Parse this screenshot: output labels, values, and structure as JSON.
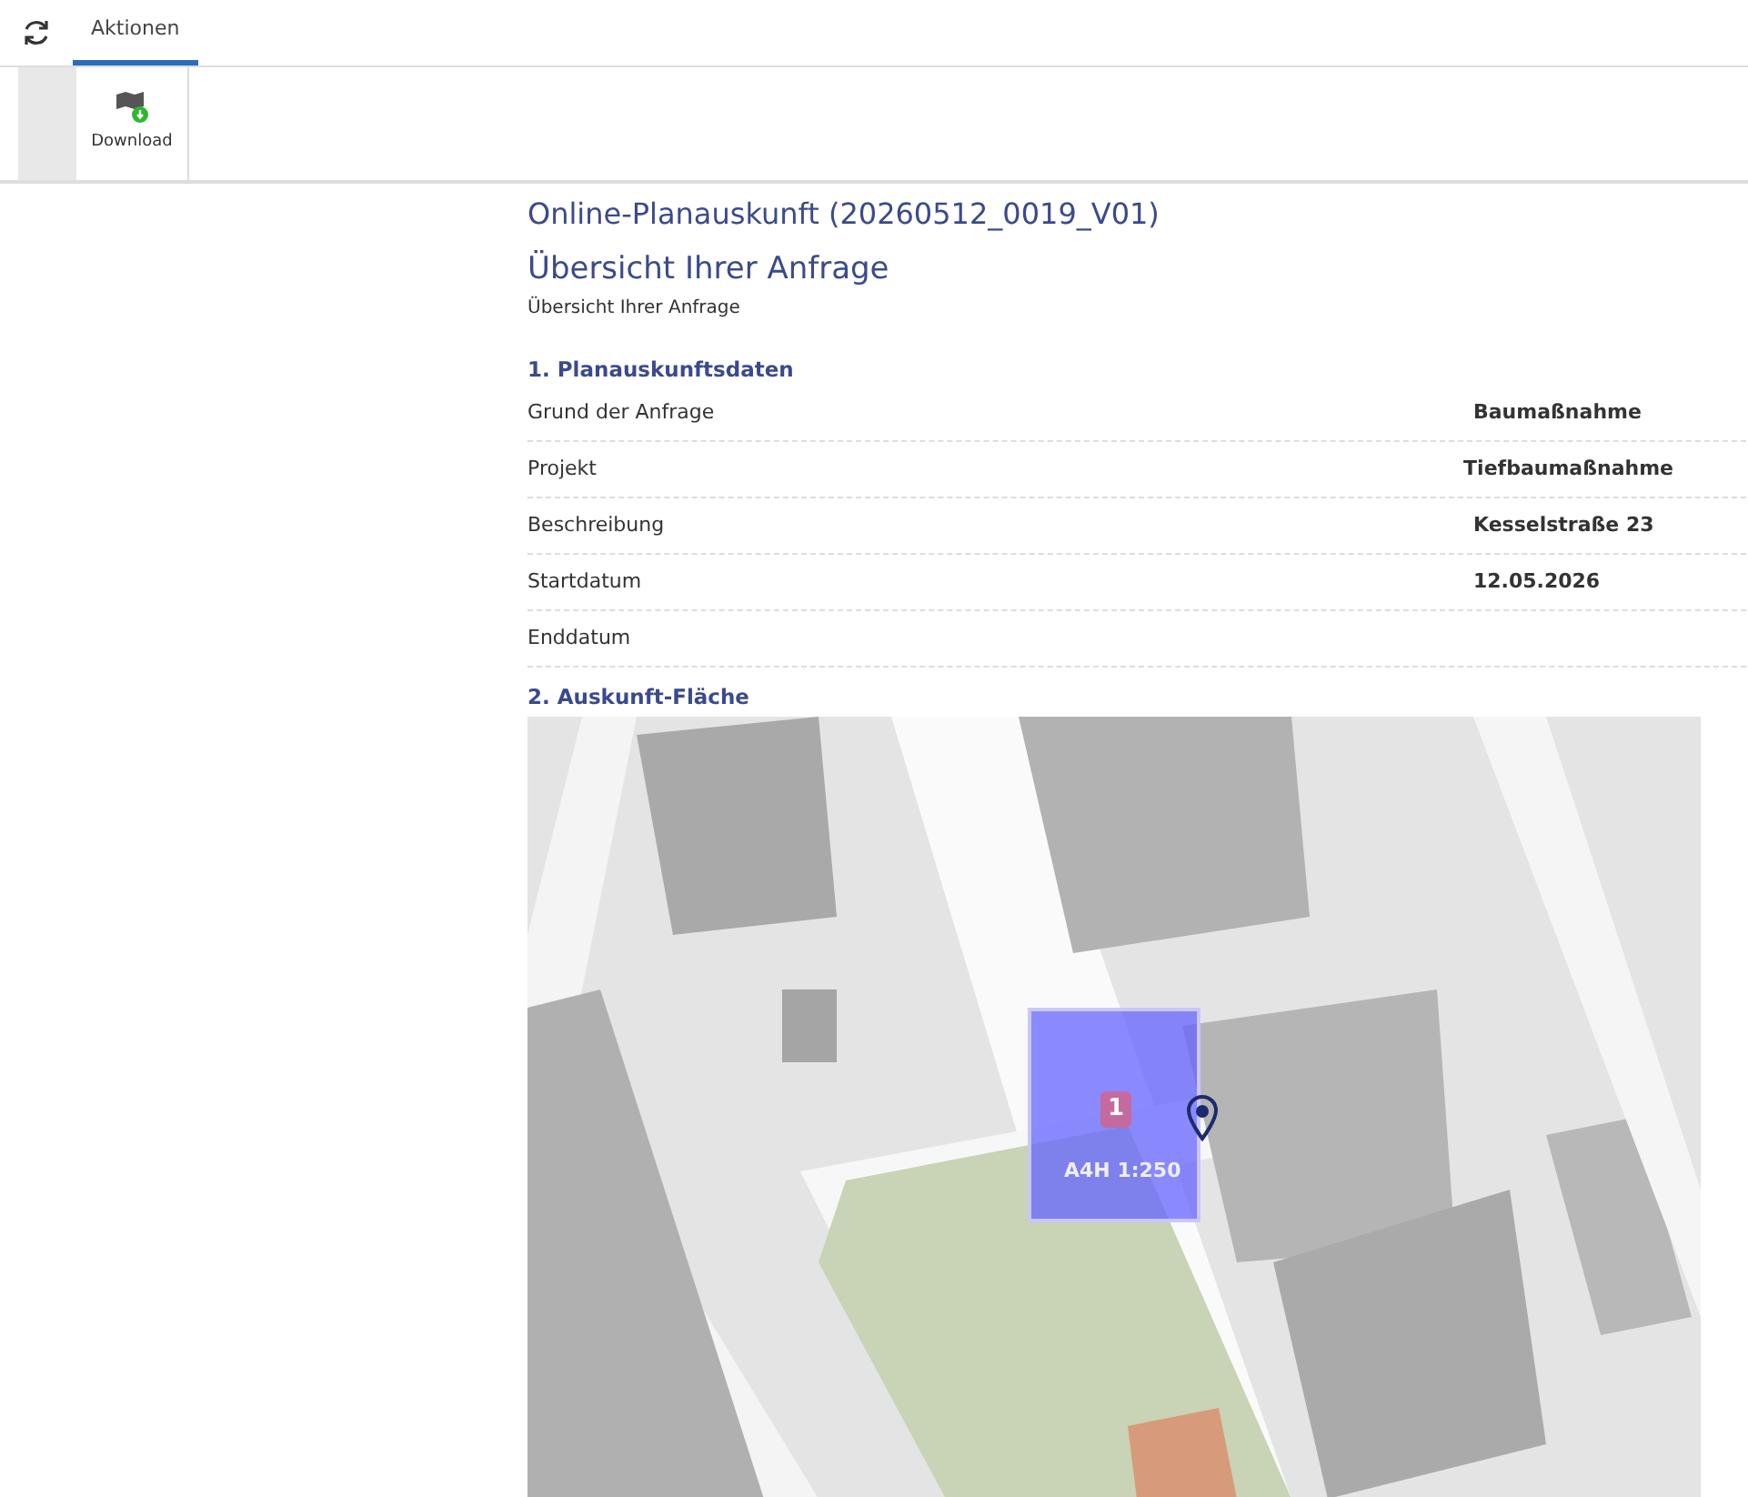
{
  "tabs": [
    {
      "label": "Aktionen",
      "selected": true
    }
  ],
  "actions": [
    {
      "label": "Download"
    }
  ],
  "title": "Online-Planauskunft (20260512_0019_V01)",
  "heading": "Übersicht Ihrer Anfrage",
  "subheading": "Übersicht Ihrer Anfrage",
  "details": {
    "title": "1. Planauskunftsdaten",
    "rows": [
      {
        "label": "Grund der Anfrage",
        "value": "Baumaßnahme"
      },
      {
        "label": "Projekt",
        "value": "Tiefbaumaßnahme"
      },
      {
        "label": "Beschreibung",
        "value": "Kesselstraße 23"
      },
      {
        "label": "Startdatum",
        "value": "12.05.2026"
      },
      {
        "label": "Enddatum"
      }
    ]
  },
  "area": {
    "title": "2. Auskunft-Fläche",
    "map": {
      "kind": "picture",
      "plan_area": {
        "number": "1",
        "label": "A4H 1:250"
      }
    }
  }
}
